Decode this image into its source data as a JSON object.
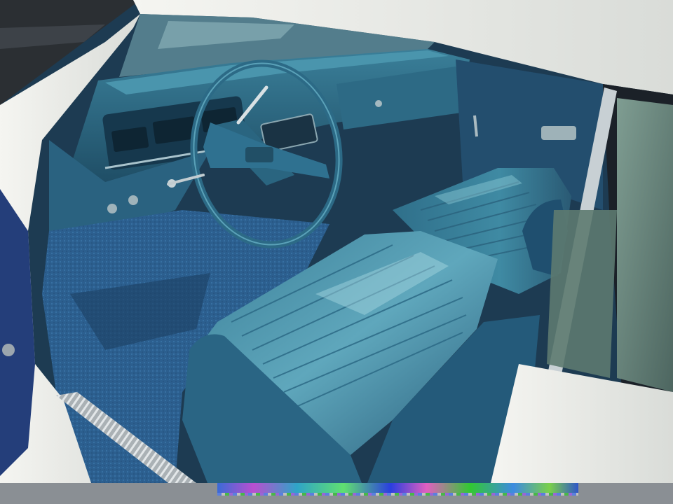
{
  "photo": {
    "subject": "",
    "colors": {
      "interior_blue": "#2f6f8f",
      "seat_teal": "#3f8fa8",
      "seat_highlight": "#7fc3d3",
      "dash_blue": "#2e6680",
      "carpet_blue": "#2a5c8a",
      "body_white": "#f2f2ee",
      "door_frame_dark": "#1d2530",
      "window_glass": "#6e8a80",
      "sill_chrome": "#b9bfc3"
    },
    "elements": [
      "steering-wheel-icon",
      "bench-seat",
      "dashboard",
      "instrument-cluster",
      "door-panel",
      "door-sill-plate",
      "windshield",
      "side-window",
      "carpet-floor",
      "turn-signal-stalk"
    ]
  }
}
